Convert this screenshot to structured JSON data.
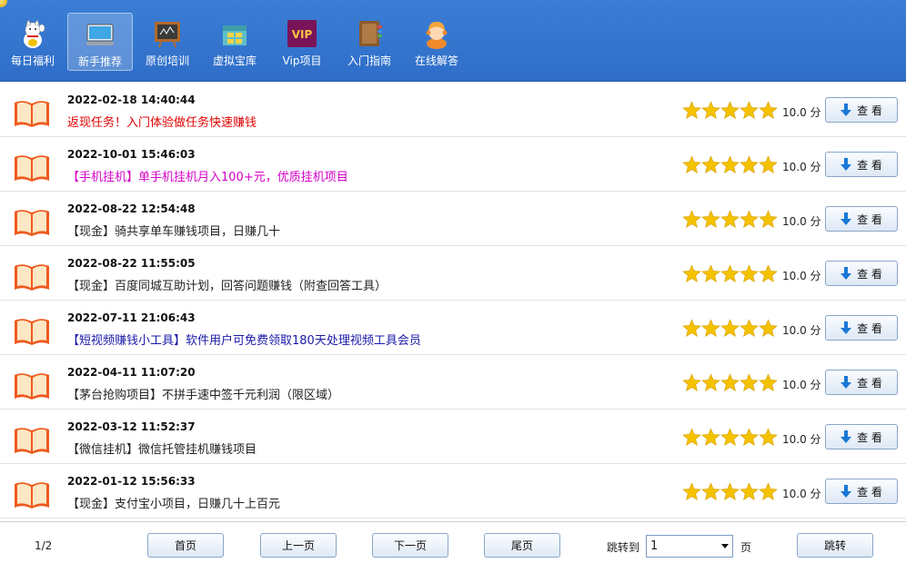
{
  "nav": {
    "items": [
      {
        "label": "每日福利",
        "icon": "lucky-cat-icon"
      },
      {
        "label": "新手推荐",
        "icon": "monitor-icon",
        "active": true
      },
      {
        "label": "原创培训",
        "icon": "chalkboard-icon"
      },
      {
        "label": "虚拟宝库",
        "icon": "treasure-box-icon"
      },
      {
        "label": "Vip项目",
        "icon": "vip-icon",
        "icon_text": "VIP"
      },
      {
        "label": "入门指南",
        "icon": "guide-book-icon"
      },
      {
        "label": "在线解答",
        "icon": "support-agent-icon"
      }
    ]
  },
  "list": {
    "rows": [
      {
        "date": "2022-02-18 14:40:44",
        "title": "返现任务！入门体验做任务快速赚钱",
        "title_color": "#e00000",
        "score": "10.0 分",
        "view_label": "查 看"
      },
      {
        "date": "2022-10-01 15:46:03",
        "title": "【手机挂机】单手机挂机月入100+元，优质挂机项目",
        "title_color": "#d400c8",
        "score": "10.0 分",
        "view_label": "查 看"
      },
      {
        "date": "2022-08-22 12:54:48",
        "title": "【现金】骑共享单车赚钱项目，日赚几十",
        "title_color": "#222222",
        "score": "10.0 分",
        "view_label": "查 看"
      },
      {
        "date": "2022-08-22 11:55:05",
        "title": "【现金】百度同城互助计划，回答问题赚钱（附查回答工具）",
        "title_color": "#222222",
        "score": "10.0 分",
        "view_label": "查 看"
      },
      {
        "date": "2022-07-11 21:06:43",
        "title": "【短视频赚钱小工具】软件用户可免费领取180天处理视频工具会员",
        "title_color": "#1a1aa8",
        "score": "10.0 分",
        "view_label": "查 看"
      },
      {
        "date": "2022-04-11 11:07:20",
        "title": "【茅台抢购项目】不拼手速中签千元利润（限区域）",
        "title_color": "#222222",
        "score": "10.0 分",
        "view_label": "查 看"
      },
      {
        "date": "2022-03-12 11:52:37",
        "title": "【微信挂机】微信托管挂机赚钱项目",
        "title_color": "#222222",
        "score": "10.0 分",
        "view_label": "查 看"
      },
      {
        "date": "2022-01-12 15:56:33",
        "title": "【现金】支付宝小项目，日赚几十上百元",
        "title_color": "#222222",
        "score": "10.0 分",
        "view_label": "查 看"
      }
    ],
    "stars_per_row": 5,
    "star_color": "#f5c200"
  },
  "pager": {
    "info": "1/2",
    "first": "首页",
    "prev": "上一页",
    "next": "下一页",
    "last": "尾页",
    "jump_label": "跳转到",
    "selected_page": "1",
    "page_suffix": "页",
    "go": "跳转"
  },
  "colors": {
    "toolbar_blue": "#3178d0",
    "button_border": "#8aa6c8"
  }
}
